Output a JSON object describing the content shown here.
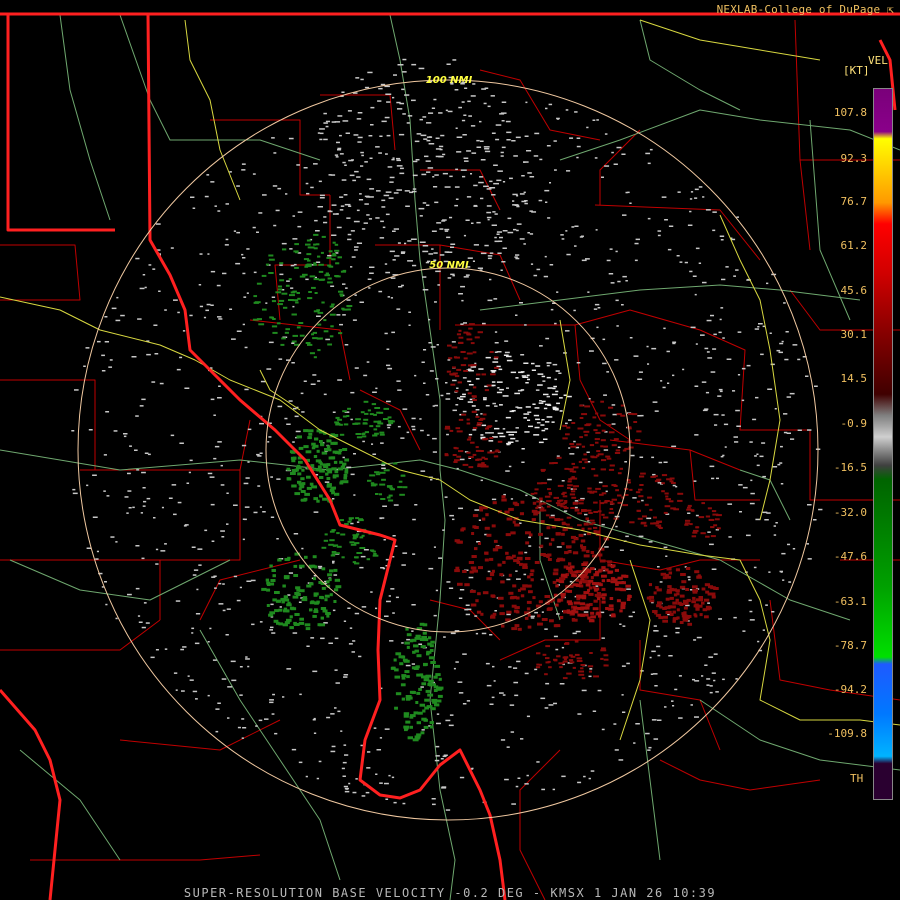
{
  "header": {
    "credit": "NEXLAB-College of DuPage"
  },
  "map": {
    "range_rings": [
      {
        "label": "50 NMI"
      },
      {
        "label": "100 NMI"
      }
    ]
  },
  "legend": {
    "title": "VEL",
    "unit": "[KT]",
    "ticks": [
      "107.8",
      "92.3",
      "76.7",
      "61.2",
      "45.6",
      "30.1",
      "14.5",
      "-0.9",
      "-16.5",
      "-32.0",
      "-47.6",
      "-63.1",
      "-78.7",
      "-94.2",
      "-109.8"
    ],
    "bottom_label": "TH",
    "colors": {
      "top": "#7a007a",
      "yellow": "#ffff00",
      "red": "#ff0000",
      "darkred": "#8a0000",
      "gray": "#cfcfcf",
      "darkgreen": "#006400",
      "green": "#00e000",
      "blue": "#1e5aff",
      "cyan": "#00b4ff",
      "purple_th": "#2a0030"
    }
  },
  "caption": "SUPER-RESOLUTION BASE VELOCITY -0.2 DEG - KMSX 1 JAN 26 10:39",
  "colors": {
    "state_border": "#ff2020",
    "county_border": "#c00000",
    "highway": "#6fa86f",
    "river": "#d8d840",
    "range_ring": "#f0c8a0",
    "inbound": "#1f8a1f",
    "outbound": "#8a0a0a",
    "near_zero": "#c8c8c8"
  }
}
